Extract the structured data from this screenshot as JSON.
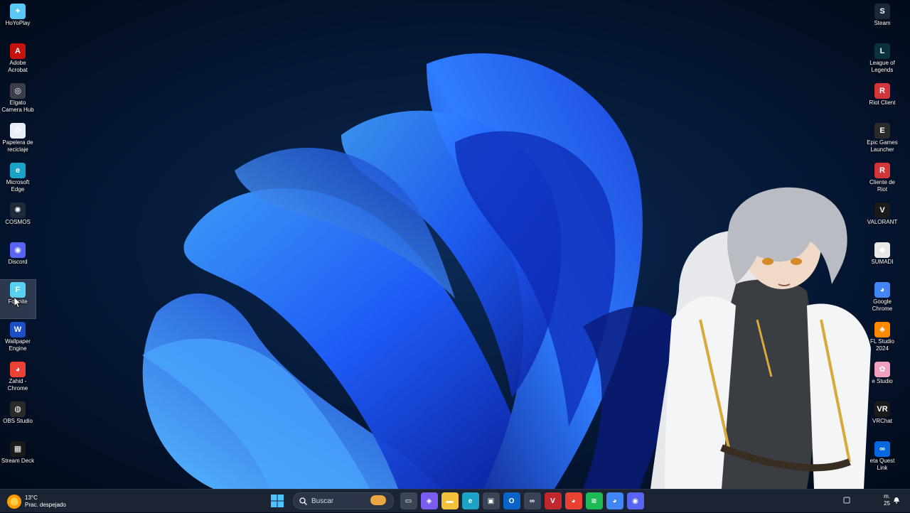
{
  "desktop": {
    "left_icons": [
      {
        "label": "HoYoPlay",
        "icon": "hoyoplay-icon",
        "color": "#5ac8f5",
        "glyph": "✦"
      },
      {
        "label": "Adobe Acrobat",
        "icon": "acrobat-icon",
        "color": "#c4120f",
        "glyph": "A"
      },
      {
        "label": "Elgato Camera Hub",
        "icon": "elgato-camera-icon",
        "color": "#3a3f4a",
        "glyph": "◎"
      },
      {
        "label": "Papelera de reciclaje",
        "icon": "recycle-bin-icon",
        "color": "#e8eef5",
        "glyph": "♻"
      },
      {
        "label": "Microsoft Edge",
        "icon": "edge-icon",
        "color": "#1aa3c6",
        "glyph": "e"
      },
      {
        "label": "COSMOS",
        "icon": "cosmos-icon",
        "color": "#1e2a3a",
        "glyph": "✺"
      },
      {
        "label": "Discord",
        "icon": "discord-icon",
        "color": "#5865f2",
        "glyph": "◉"
      },
      {
        "label": "Fortnite",
        "icon": "fortnite-icon",
        "color": "#5ad0f0",
        "glyph": "F"
      },
      {
        "label": "Wallpaper Engine",
        "icon": "wallpaper-engine-icon",
        "color": "#1d4fc4",
        "glyph": "W"
      },
      {
        "label": "Zahid - Chrome",
        "icon": "chrome-profile-icon",
        "color": "#e94235",
        "glyph": "◕"
      },
      {
        "label": "OBS Studio",
        "icon": "obs-icon",
        "color": "#2a2a2a",
        "glyph": "◍"
      },
      {
        "label": "Stream Deck",
        "icon": "stream-deck-icon",
        "color": "#1a1a1a",
        "glyph": "▦"
      }
    ],
    "right_icons": [
      {
        "label": "Steam",
        "icon": "steam-icon",
        "color": "#1b2838",
        "glyph": "S"
      },
      {
        "label": "League of Legends",
        "icon": "league-icon",
        "color": "#0a323c",
        "glyph": "L"
      },
      {
        "label": "Riot Client",
        "icon": "riot-client-icon",
        "color": "#d13639",
        "glyph": "R"
      },
      {
        "label": "Epic Games Launcher",
        "icon": "epic-games-icon",
        "color": "#2a2a2a",
        "glyph": "E"
      },
      {
        "label": "Cliente de Riot",
        "icon": "riot-client-icon",
        "color": "#d13639",
        "glyph": "R"
      },
      {
        "label": "VALORANT",
        "icon": "valorant-icon",
        "color": "#1a1a1a",
        "glyph": "V"
      },
      {
        "label": "SUMADI",
        "icon": "sumadi-icon",
        "color": "#e8e8e8",
        "glyph": "◆"
      },
      {
        "label": "Google Chrome",
        "icon": "chrome-icon",
        "color": "#4285f4",
        "glyph": "◕"
      },
      {
        "label": "FL Studio 2024",
        "icon": "fl-studio-icon",
        "color": "#ff8a00",
        "glyph": "♣"
      },
      {
        "label": "e Studio",
        "icon": "studio-icon",
        "color": "#f2a0c0",
        "glyph": "✿"
      },
      {
        "label": "VRChat",
        "icon": "vrchat-icon",
        "color": "#1a1a1a",
        "glyph": "VR"
      },
      {
        "label": "eta Quest Link",
        "icon": "meta-quest-icon",
        "color": "#0668e1",
        "glyph": "∞"
      }
    ]
  },
  "taskbar": {
    "weather_temp": "13°C",
    "weather_desc": "Prac. despejado",
    "search_placeholder": "Buscar",
    "pinned": [
      {
        "icon": "task-view-icon",
        "color": "#3c4556",
        "glyph": "▭"
      },
      {
        "icon": "copilot-icon",
        "color": "#7b5cf0",
        "glyph": "◈"
      },
      {
        "icon": "file-explorer-icon",
        "color": "#f3c13a",
        "glyph": "▬"
      },
      {
        "icon": "edge-taskbar-icon",
        "color": "#1aa3c6",
        "glyph": "e"
      },
      {
        "icon": "microsoft-store-icon",
        "color": "#3a4456",
        "glyph": "▣"
      },
      {
        "icon": "outlook-icon",
        "color": "#0a64c8",
        "glyph": "O"
      },
      {
        "icon": "meta-quest-taskbar-icon",
        "color": "#3a4456",
        "glyph": "∞"
      },
      {
        "icon": "voicemeeter-icon",
        "color": "#c0282d",
        "glyph": "V"
      },
      {
        "icon": "chrome-profile-taskbar-icon",
        "color": "#e94235",
        "glyph": "◕"
      },
      {
        "icon": "spotify-icon",
        "color": "#1db954",
        "glyph": "≋"
      },
      {
        "icon": "chrome-taskbar-icon",
        "color": "#4285f4",
        "glyph": "◕"
      },
      {
        "icon": "discord-taskbar-icon",
        "color": "#5865f2",
        "glyph": "◉"
      }
    ],
    "clock_line1": "m.",
    "clock_line2": "25"
  },
  "colors": {
    "background": "#020a1c",
    "taskbar": "#1c2433",
    "wallpaper_accent": "#1e5cff",
    "start_blue": "#4cc2ff"
  }
}
